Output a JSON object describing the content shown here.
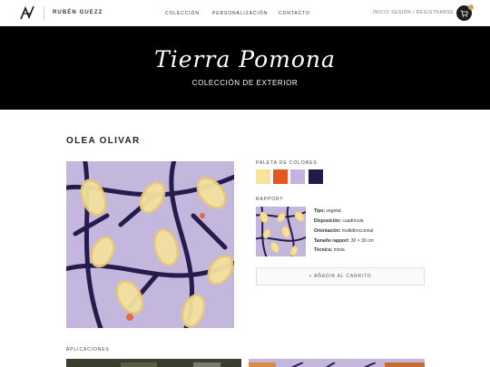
{
  "header": {
    "brand": "RUBÉN GUEZZ",
    "nav": [
      "COLECCIÓN",
      "PERSONALIZACIÓN",
      "CONTACTO"
    ],
    "account": "INICIO SESIÓN / REGISTRARSE"
  },
  "hero": {
    "title": "Tierra Pomona",
    "subtitle": "COLECCIÓN DE EXTERIOR"
  },
  "product": {
    "name": "OLEA OLIVAR",
    "palette_label": "PALETA DE COLORES",
    "palette": [
      "#f6e39c",
      "#e5571e",
      "#c3b3dd",
      "#221a49"
    ],
    "rapport_label": "RAPPORT",
    "specs": [
      {
        "key": "Tipo:",
        "value": "vegetal"
      },
      {
        "key": "Disposición:",
        "value": "cuadrícula"
      },
      {
        "key": "Orientación:",
        "value": "multidireccional"
      },
      {
        "key": "Tamaño rapport:",
        "value": "30 × 30 cm"
      },
      {
        "key": "Técnica:",
        "value": "mixta"
      }
    ],
    "add_to_cart": "+ AÑADIR AL CARRITO"
  },
  "applications": {
    "label": "APLICACIONES"
  }
}
